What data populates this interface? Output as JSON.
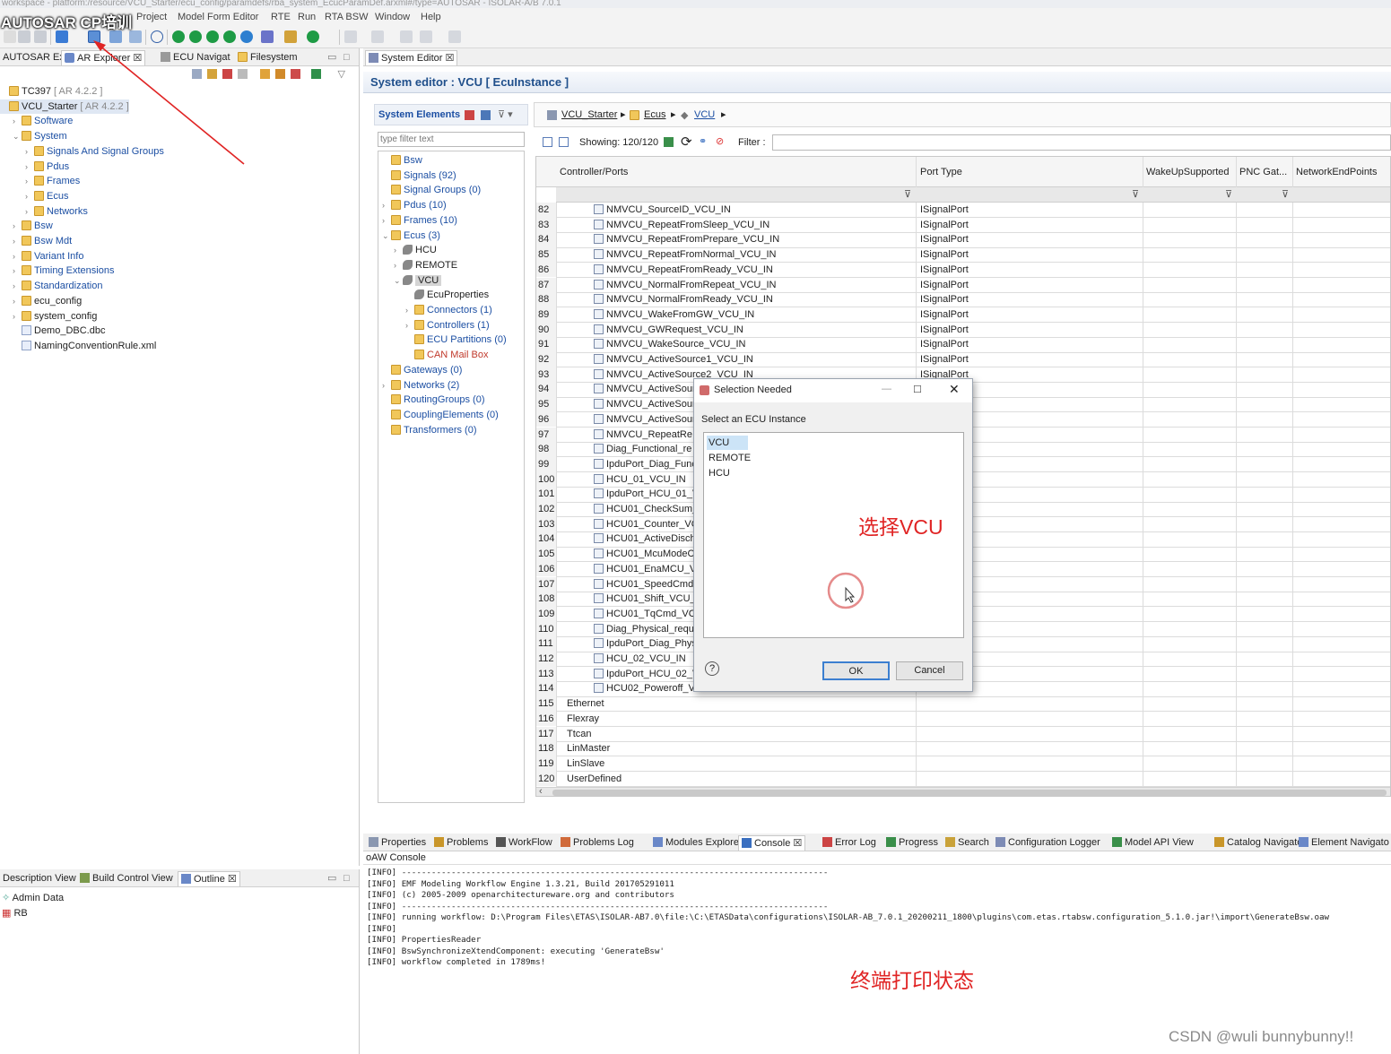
{
  "window": {
    "path_text": "workspace - platform:/resource/VCU_Starter/ecu_config/paramdefs/rba_system_EcucParamDef.arxml#/type=AUTOSAR - ISOLAR-A/B 7.0.1",
    "overlay_title": "AUTOSAR CP培训"
  },
  "menu": [
    "Project",
    "Model Form Editor",
    "RTE",
    "Run",
    "RTA BSW",
    "Window",
    "Help"
  ],
  "left_tabs": [
    "AUTOSAR Ex",
    "AR Explorer",
    "ECU Navigat",
    "Filesystem"
  ],
  "left_tree": [
    {
      "label": "TC397",
      "suffix": "[ AR 4.2.2 ]",
      "indent": 0,
      "arrow": "",
      "color": "dark"
    },
    {
      "label": "VCU_Starter",
      "suffix": "[ AR 4.2.2 ]",
      "indent": 0,
      "arrow": "",
      "color": "dark",
      "selected": true
    },
    {
      "label": "Software",
      "indent": 1,
      "arrow": ">",
      "color": "blue"
    },
    {
      "label": "System",
      "indent": 1,
      "arrow": "v",
      "color": "blue"
    },
    {
      "label": "Signals And Signal Groups",
      "indent": 2,
      "arrow": ">",
      "color": "blue"
    },
    {
      "label": "Pdus",
      "indent": 2,
      "arrow": ">",
      "color": "blue"
    },
    {
      "label": "Frames",
      "indent": 2,
      "arrow": ">",
      "color": "blue"
    },
    {
      "label": "Ecus",
      "indent": 2,
      "arrow": ">",
      "color": "blue"
    },
    {
      "label": "Networks",
      "indent": 2,
      "arrow": ">",
      "color": "blue"
    },
    {
      "label": "Bsw",
      "indent": 1,
      "arrow": ">",
      "color": "blue"
    },
    {
      "label": "Bsw Mdt",
      "indent": 1,
      "arrow": ">",
      "color": "blue"
    },
    {
      "label": "Variant Info",
      "indent": 1,
      "arrow": ">",
      "color": "blue"
    },
    {
      "label": "Timing Extensions",
      "indent": 1,
      "arrow": ">",
      "color": "blue"
    },
    {
      "label": "Standardization",
      "indent": 1,
      "arrow": ">",
      "color": "blue"
    },
    {
      "label": "ecu_config",
      "indent": 1,
      "arrow": ">",
      "color": "dark"
    },
    {
      "label": "system_config",
      "indent": 1,
      "arrow": ">",
      "color": "dark"
    },
    {
      "label": "Demo_DBC.dbc",
      "indent": 1,
      "arrow": "",
      "color": "dark"
    },
    {
      "label": "NamingConventionRule.xml",
      "indent": 1,
      "arrow": "",
      "color": "dark"
    }
  ],
  "left_bottom": {
    "tabs": [
      "Description View",
      "Build Control View",
      "Outline"
    ],
    "items": [
      "Admin Data",
      "RB"
    ]
  },
  "editor": {
    "tab": "System Editor",
    "header": "System editor : VCU [ EcuInstance ]",
    "sys_elements_label": "System Elements",
    "filter_placeholder": "type filter text",
    "breadcrumb": [
      "VCU_Starter",
      "Ecus",
      "VCU"
    ],
    "showing": "Showing: 120/120",
    "filter_label": "Filter :"
  },
  "sys_tree": [
    {
      "label": "Bsw",
      "indent": 0,
      "arrow": ""
    },
    {
      "label": "Signals (92)",
      "indent": 0,
      "arrow": ""
    },
    {
      "label": "Signal Groups (0)",
      "indent": 0,
      "arrow": ""
    },
    {
      "label": "Pdus (10)",
      "indent": 0,
      "arrow": ">"
    },
    {
      "label": "Frames (10)",
      "indent": 0,
      "arrow": ">"
    },
    {
      "label": "Ecus (3)",
      "indent": 0,
      "arrow": "v"
    },
    {
      "label": "HCU",
      "indent": 1,
      "arrow": ">",
      "dark": true
    },
    {
      "label": "REMOTE",
      "indent": 1,
      "arrow": ">",
      "dark": true
    },
    {
      "label": "VCU",
      "indent": 1,
      "arrow": "v",
      "dark": true,
      "selected": true
    },
    {
      "label": "EcuProperties",
      "indent": 2,
      "arrow": "",
      "dark": true
    },
    {
      "label": "Connectors (1)",
      "indent": 2,
      "arrow": ">"
    },
    {
      "label": "Controllers (1)",
      "indent": 2,
      "arrow": ">"
    },
    {
      "label": "ECU Partitions (0)",
      "indent": 2,
      "arrow": ""
    },
    {
      "label": "CAN Mail Box",
      "indent": 2,
      "arrow": "",
      "red": true
    },
    {
      "label": "Gateways (0)",
      "indent": 0,
      "arrow": ""
    },
    {
      "label": "Networks (2)",
      "indent": 0,
      "arrow": ">"
    },
    {
      "label": "RoutingGroups (0)",
      "indent": 0,
      "arrow": ""
    },
    {
      "label": "CouplingElements (0)",
      "indent": 0,
      "arrow": ""
    },
    {
      "label": "Transformers (0)",
      "indent": 0,
      "arrow": ""
    }
  ],
  "table": {
    "columns": [
      "Controller/Ports",
      "Port Type",
      "WakeUpSupported",
      "PNC Gat...",
      "NetworkEndPoints"
    ],
    "rows": [
      {
        "n": "82",
        "name": "NMVCU_SourceID_VCU_IN",
        "type": "ISignalPort"
      },
      {
        "n": "83",
        "name": "NMVCU_RepeatFromSleep_VCU_IN",
        "type": "ISignalPort"
      },
      {
        "n": "84",
        "name": "NMVCU_RepeatFromPrepare_VCU_IN",
        "type": "ISignalPort"
      },
      {
        "n": "85",
        "name": "NMVCU_RepeatFromNormal_VCU_IN",
        "type": "ISignalPort"
      },
      {
        "n": "86",
        "name": "NMVCU_RepeatFromReady_VCU_IN",
        "type": "ISignalPort"
      },
      {
        "n": "87",
        "name": "NMVCU_NormalFromRepeat_VCU_IN",
        "type": "ISignalPort"
      },
      {
        "n": "88",
        "name": "NMVCU_NormalFromReady_VCU_IN",
        "type": "ISignalPort"
      },
      {
        "n": "89",
        "name": "NMVCU_WakeFromGW_VCU_IN",
        "type": "ISignalPort"
      },
      {
        "n": "90",
        "name": "NMVCU_GWRequest_VCU_IN",
        "type": "ISignalPort"
      },
      {
        "n": "91",
        "name": "NMVCU_WakeSource_VCU_IN",
        "type": "ISignalPort"
      },
      {
        "n": "92",
        "name": "NMVCU_ActiveSource1_VCU_IN",
        "type": "ISignalPort"
      },
      {
        "n": "93",
        "name": "NMVCU_ActiveSource2_VCU_IN",
        "type": "ISignalPort"
      },
      {
        "n": "94",
        "name": "NMVCU_ActiveSour",
        "type": ""
      },
      {
        "n": "95",
        "name": "NMVCU_ActiveSour",
        "type": ""
      },
      {
        "n": "96",
        "name": "NMVCU_ActiveSour",
        "type": ""
      },
      {
        "n": "97",
        "name": "NMVCU_RepeatRe",
        "type": ""
      },
      {
        "n": "98",
        "name": "Diag_Functional_re",
        "type": ""
      },
      {
        "n": "99",
        "name": "IpduPort_Diag_Func",
        "type": ""
      },
      {
        "n": "100",
        "name": "HCU_01_VCU_IN",
        "type": ""
      },
      {
        "n": "101",
        "name": "IpduPort_HCU_01_V",
        "type": ""
      },
      {
        "n": "102",
        "name": "HCU01_CheckSum_",
        "type": ""
      },
      {
        "n": "103",
        "name": "HCU01_Counter_VC",
        "type": ""
      },
      {
        "n": "104",
        "name": "HCU01_ActiveDisch",
        "type": ""
      },
      {
        "n": "105",
        "name": "HCU01_McuModeC",
        "type": ""
      },
      {
        "n": "106",
        "name": "HCU01_EnaMCU_V",
        "type": ""
      },
      {
        "n": "107",
        "name": "HCU01_SpeedCmd_",
        "type": ""
      },
      {
        "n": "108",
        "name": "HCU01_Shift_VCU_I",
        "type": ""
      },
      {
        "n": "109",
        "name": "HCU01_TqCmd_VC",
        "type": ""
      },
      {
        "n": "110",
        "name": "Diag_Physical_requ",
        "type": ""
      },
      {
        "n": "111",
        "name": "IpduPort_Diag_Phys",
        "type": ""
      },
      {
        "n": "112",
        "name": "HCU_02_VCU_IN",
        "type": ""
      },
      {
        "n": "113",
        "name": "IpduPort_HCU_02_V",
        "type": ""
      },
      {
        "n": "114",
        "name": "HCU02_Poweroff_V",
        "type": ""
      },
      {
        "n": "115",
        "name": "Ethernet",
        "type": "",
        "group": true
      },
      {
        "n": "116",
        "name": "Flexray",
        "type": "",
        "group": true
      },
      {
        "n": "117",
        "name": "Ttcan",
        "type": "",
        "group": true
      },
      {
        "n": "118",
        "name": "LinMaster",
        "type": "",
        "group": true
      },
      {
        "n": "119",
        "name": "LinSlave",
        "type": "",
        "group": true
      },
      {
        "n": "120",
        "name": "UserDefined",
        "type": "",
        "group": true
      }
    ]
  },
  "dialog": {
    "title": "Selection Needed",
    "prompt": "Select an ECU Instance",
    "options": [
      "VCU",
      "REMOTE",
      "HCU"
    ],
    "selected": "VCU",
    "ok": "OK",
    "cancel": "Cancel"
  },
  "annotations": {
    "choose_vcu": "选择VCU",
    "console_note": "终端打印状态"
  },
  "bottom_tabs": [
    "Properties",
    "Problems",
    "WorkFlow",
    "Problems Log",
    "Modules Explorer",
    "Console",
    "Error Log",
    "Progress",
    "Search",
    "Configuration Logger",
    "Model API View",
    "Catalog Navigator",
    "Element Navigato"
  ],
  "console": {
    "title": "oAW Console",
    "lines": [
      "[INFO] --------------------------------------------------------------------------------------",
      "[INFO] EMF Modeling Workflow Engine 1.3.21, Build 201705291011",
      "[INFO] (c) 2005-2009 openarchitectureware.org and contributors",
      "[INFO] --------------------------------------------------------------------------------------",
      "[INFO] running workflow: D:\\Program Files\\ETAS\\ISOLAR-AB7.0\\file:\\C:\\ETASData\\configurations\\ISOLAR-AB_7.0.1_20200211_1800\\plugins\\com.etas.rtabsw.configuration_5.1.0.jar!\\import\\GenerateBsw.oaw",
      "[INFO]",
      "[INFO] PropertiesReader",
      "[INFO] BswSynchronizeXtendComponent: executing 'GenerateBsw'",
      "[INFO] workflow completed in 1789ms!"
    ]
  },
  "watermark": "CSDN @wuli  bunnybunny!!",
  "colors": {
    "accent": "#1c4fa3",
    "annotation_red": "#e02424",
    "selection_blue": "#cce4f7"
  }
}
